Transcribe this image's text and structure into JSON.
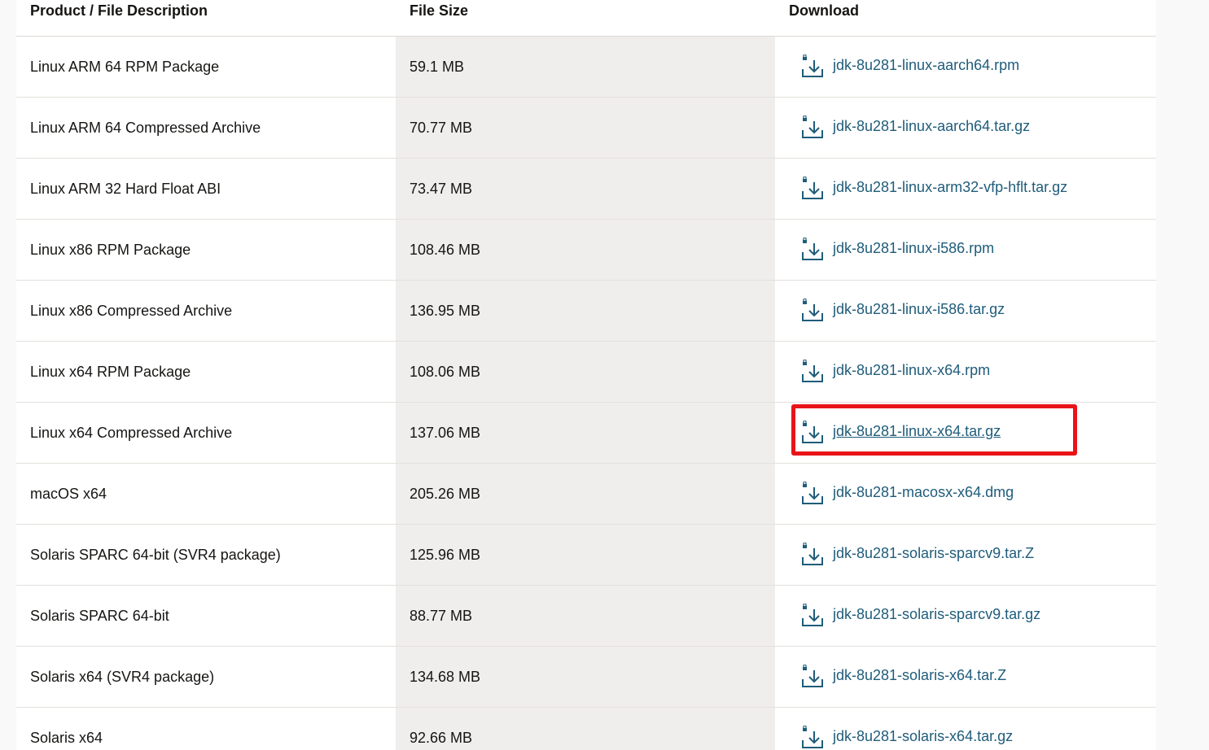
{
  "table": {
    "headers": {
      "description": "Product / File Description",
      "size": "File Size",
      "download": "Download"
    },
    "rows": [
      {
        "description": "Linux ARM 64 RPM Package",
        "size": "59.1 MB",
        "file": "jdk-8u281-linux-aarch64.rpm"
      },
      {
        "description": "Linux ARM 64 Compressed Archive",
        "size": "70.77 MB",
        "file": "jdk-8u281-linux-aarch64.tar.gz"
      },
      {
        "description": "Linux ARM 32 Hard Float ABI",
        "size": "73.47 MB",
        "file": "jdk-8u281-linux-arm32-vfp-hflt.tar.gz"
      },
      {
        "description": "Linux x86 RPM Package",
        "size": "108.46 MB",
        "file": "jdk-8u281-linux-i586.rpm"
      },
      {
        "description": "Linux x86 Compressed Archive",
        "size": "136.95 MB",
        "file": "jdk-8u281-linux-i586.tar.gz"
      },
      {
        "description": "Linux x64 RPM Package",
        "size": "108.06 MB",
        "file": "jdk-8u281-linux-x64.rpm"
      },
      {
        "description": "Linux x64 Compressed Archive",
        "size": "137.06 MB",
        "file": "jdk-8u281-linux-x64.tar.gz"
      },
      {
        "description": "macOS x64",
        "size": "205.26 MB",
        "file": "jdk-8u281-macosx-x64.dmg"
      },
      {
        "description": "Solaris SPARC 64-bit (SVR4 package)",
        "size": "125.96 MB",
        "file": "jdk-8u281-solaris-sparcv9.tar.Z"
      },
      {
        "description": "Solaris SPARC 64-bit",
        "size": "88.77 MB",
        "file": "jdk-8u281-solaris-sparcv9.tar.gz"
      },
      {
        "description": "Solaris x64 (SVR4 package)",
        "size": "134.68 MB",
        "file": "jdk-8u281-solaris-x64.tar.Z"
      },
      {
        "description": "Solaris x64",
        "size": "92.66 MB",
        "file": "jdk-8u281-solaris-x64.tar.gz"
      }
    ]
  },
  "highlighted_row": 6,
  "icons": {
    "download": "download-icon"
  },
  "colors": {
    "link": "#1f5c7a",
    "highlight": "#e8141a",
    "size_column_bg": "#efeeec"
  }
}
